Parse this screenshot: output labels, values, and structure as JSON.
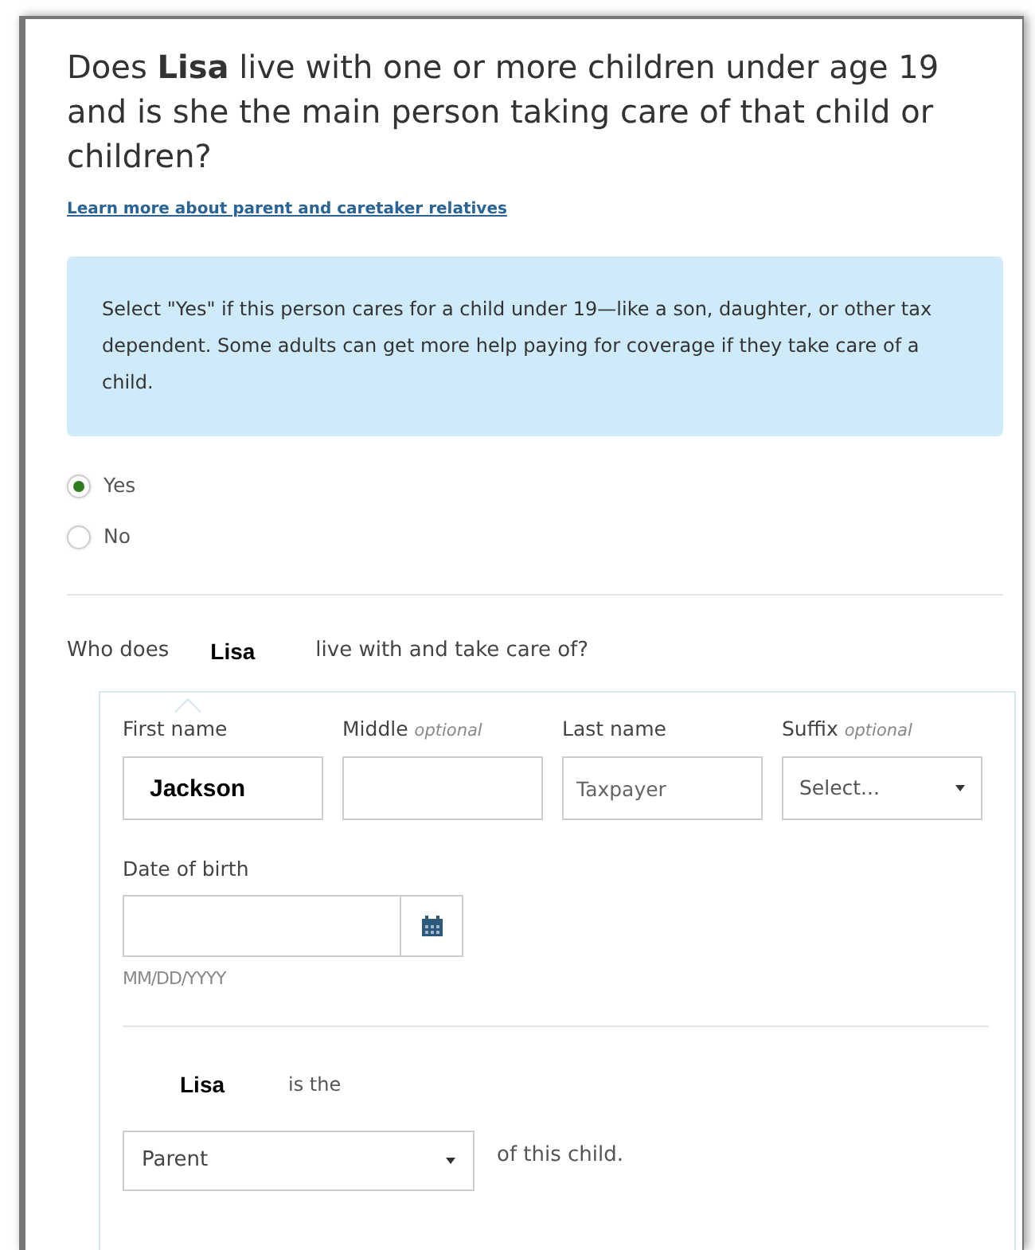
{
  "question": "Does **Lisa** live with one or more children under age 19 and is she the main person taking care of that child or children?",
  "learn_more_link": "Learn more about parent and caretaker relatives",
  "info_box": "Select \"Yes\" if this person cares for a child under 19—like a son, daughter, or other tax dependent. Some adults can get more help paying for coverage if they take care of a child.",
  "answer_options": [
    {
      "label": "Yes",
      "selected": true
    },
    {
      "label": "No",
      "selected": false
    }
  ],
  "follow_up_question": {
    "before": "Who does",
    "name": "Lisa",
    "after": "live with and take care of?"
  },
  "child": {
    "fields": [
      {
        "kind": "text",
        "label": "First name",
        "value": "Jackson"
      },
      {
        "kind": "text",
        "label": "Middle",
        "hint": "optional"
      },
      {
        "kind": "text",
        "label": "Last name",
        "placeholder": "Taxpayer"
      },
      {
        "kind": "select",
        "label": "Suffix",
        "hint": "optional",
        "value": "Select..."
      }
    ],
    "date_of_birth": {
      "label": "Date of birth",
      "format_hint": "MM/DD/YYYY"
    },
    "relationship": {
      "name": "Lisa",
      "before": "is the",
      "value": "Parent",
      "after": "of this child."
    }
  }
}
